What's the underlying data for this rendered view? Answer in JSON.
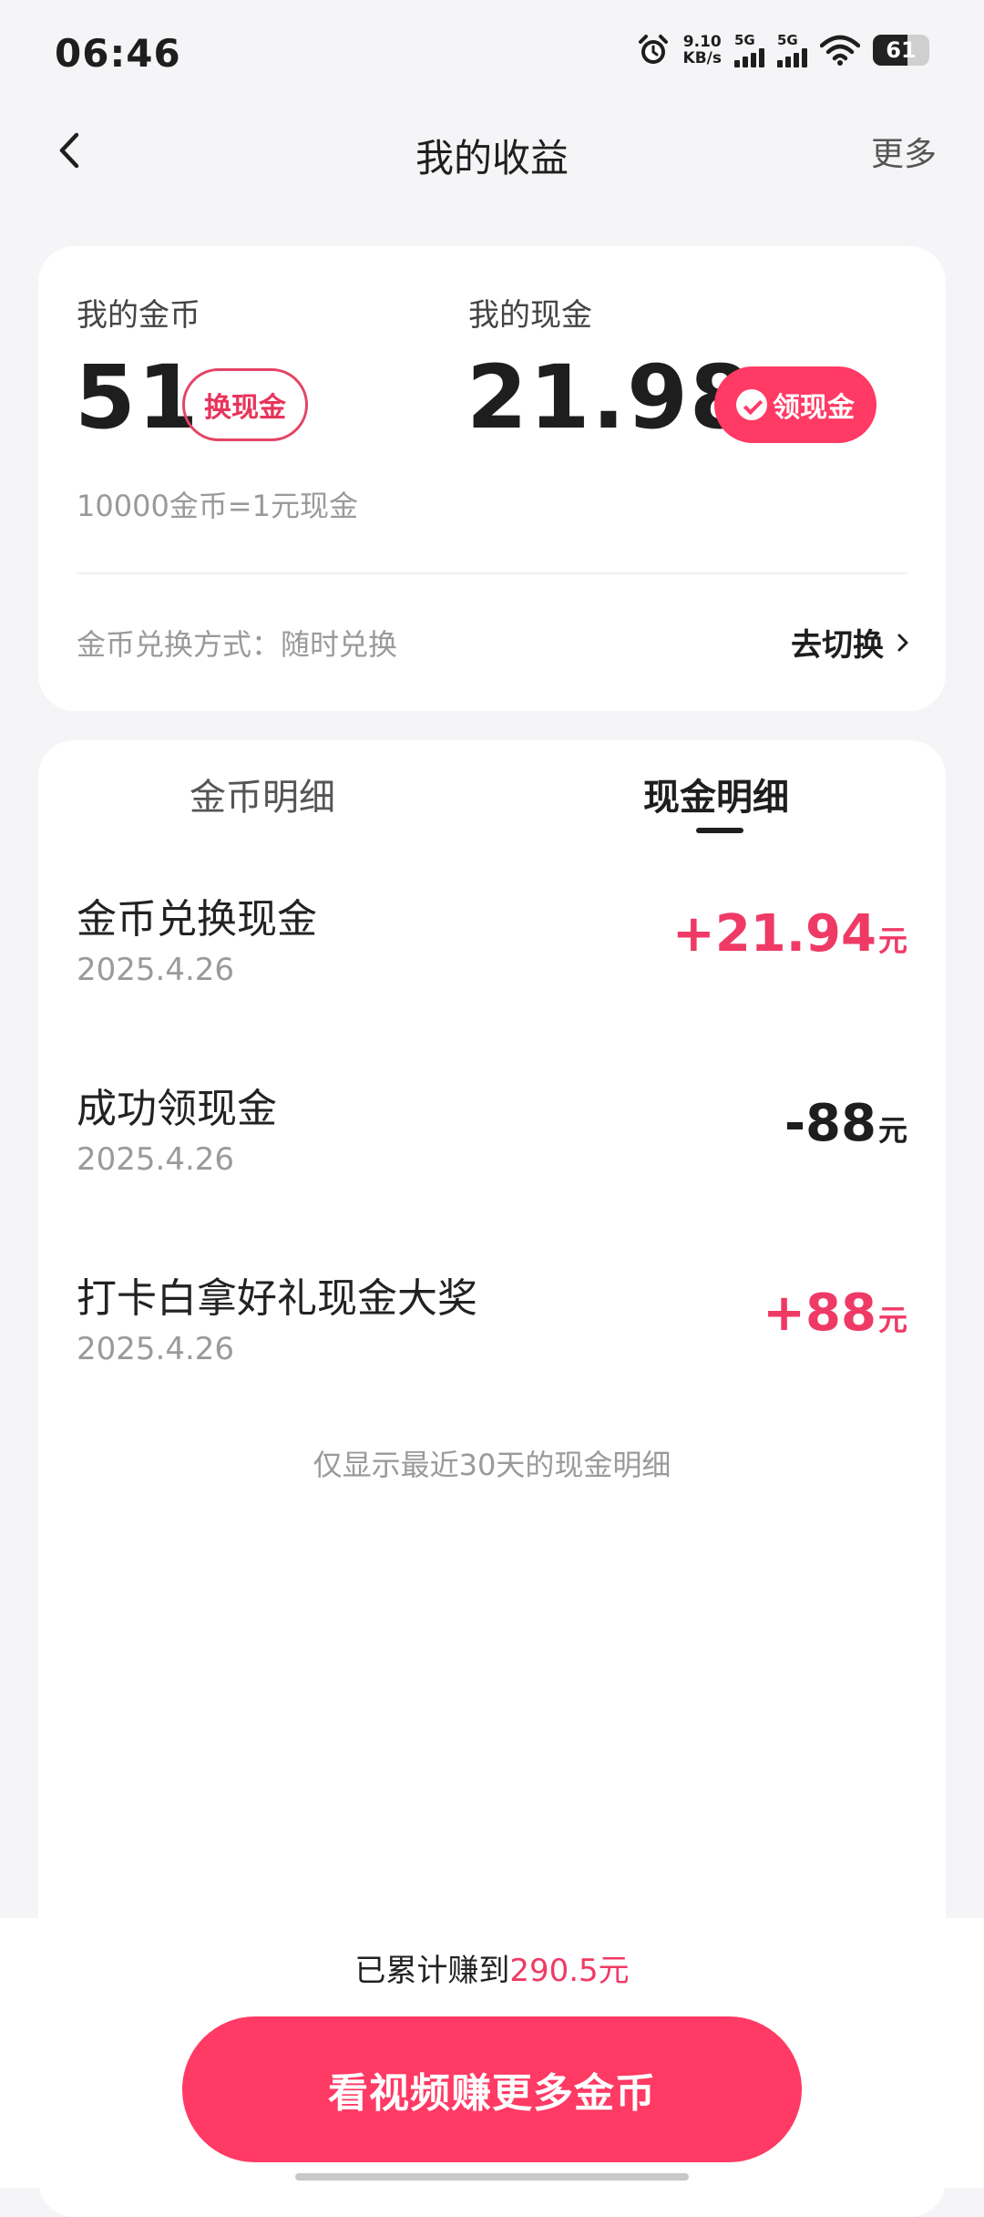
{
  "status_bar": {
    "time": "06:46",
    "net_speed_value": "9.10",
    "net_speed_unit": "KB/s",
    "sim1_label": "5G",
    "sim2_label": "5G",
    "battery": "61",
    "icons": [
      "alarm-icon",
      "signal-icon",
      "wifi-icon",
      "battery-icon"
    ]
  },
  "header": {
    "title": "我的收益",
    "more": "更多",
    "back_icon": "chevron-left-icon"
  },
  "balance_card": {
    "coins_label": "我的金币",
    "coins_value": "51",
    "exchange_button": "换现金",
    "cash_label": "我的现金",
    "cash_value": "21.98",
    "claim_button": "领现金",
    "rate_text": "10000金币=1元现金",
    "method_text": "金币兑换方式：随时兑换",
    "switch_link": "去切换"
  },
  "details": {
    "tabs": [
      {
        "label": "金币明细",
        "active": false
      },
      {
        "label": "现金明细",
        "active": true
      }
    ],
    "transactions": [
      {
        "title": "金币兑换现金",
        "date": "2025.4.26",
        "amount": "+21.94",
        "unit": "元",
        "positive": true
      },
      {
        "title": "成功领现金",
        "date": "2025.4.26",
        "amount": "-88",
        "unit": "元",
        "positive": false
      },
      {
        "title": "打卡白拿好礼现金大奖",
        "date": "2025.4.26",
        "amount": "+88",
        "unit": "元",
        "positive": true
      }
    ],
    "footnote": "仅显示最近30天的现金明细"
  },
  "footer": {
    "total_prefix": "已累计赚到",
    "total_value": "290.5元",
    "cta_button": "看视频赚更多金币"
  },
  "colors": {
    "accent": "#ff3a64",
    "positive_amount": "#ef3a66",
    "text_primary": "#1e1e1e",
    "text_secondary": "#9a9a9a",
    "background": "#f5f5f7"
  }
}
